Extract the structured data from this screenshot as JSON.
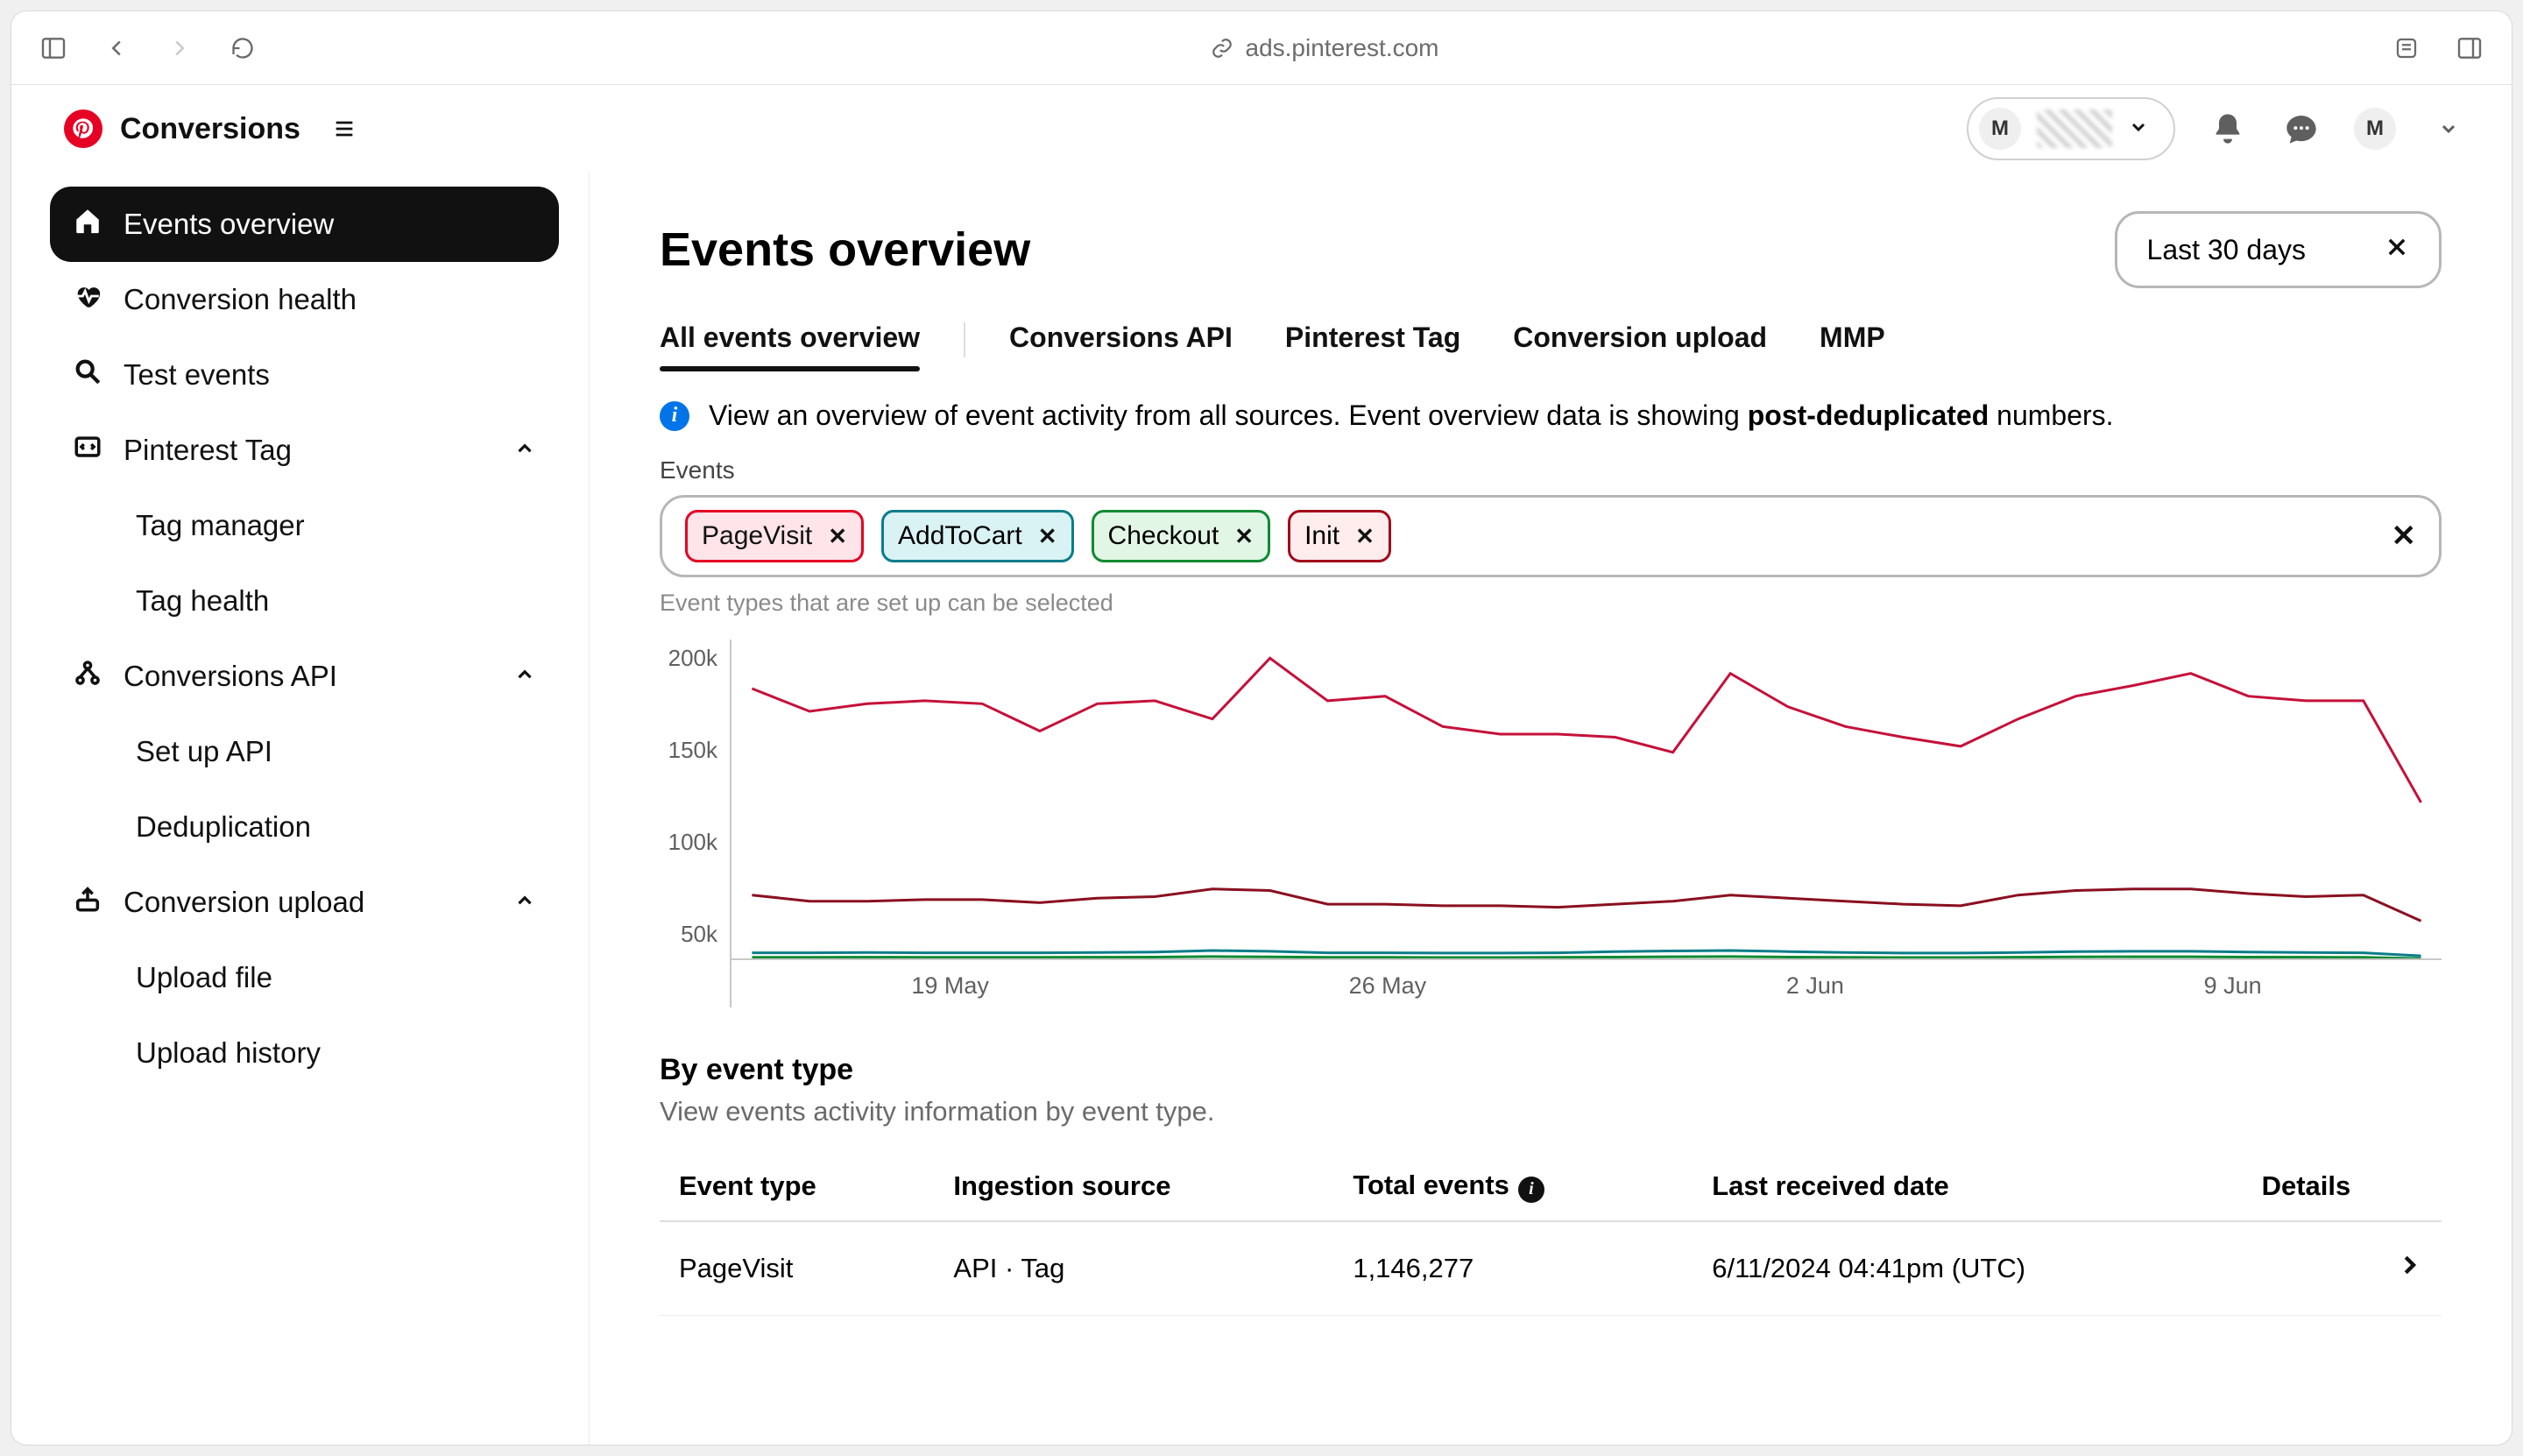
{
  "browser": {
    "url": "ads.pinterest.com"
  },
  "header": {
    "app_title": "Conversions",
    "account_initial": "M",
    "user_initial": "M"
  },
  "sidebar": {
    "items": [
      {
        "label": "Events overview"
      },
      {
        "label": "Conversion health"
      },
      {
        "label": "Test events"
      },
      {
        "label": "Pinterest Tag",
        "children": [
          {
            "label": "Tag manager"
          },
          {
            "label": "Tag health"
          }
        ]
      },
      {
        "label": "Conversions API",
        "children": [
          {
            "label": "Set up API"
          },
          {
            "label": "Deduplication"
          }
        ]
      },
      {
        "label": "Conversion upload",
        "children": [
          {
            "label": "Upload file"
          },
          {
            "label": "Upload history"
          }
        ]
      }
    ]
  },
  "main": {
    "title": "Events overview",
    "date_range": "Last 30 days",
    "tabs": [
      "All events overview",
      "Conversions API",
      "Pinterest Tag",
      "Conversion upload",
      "MMP"
    ],
    "info_prefix": "View an overview of event activity from all sources. Event overview data is showing ",
    "info_bold": "post-deduplicated",
    "info_suffix": " numbers.",
    "events_label": "Events",
    "chips": [
      {
        "label": "PageVisit",
        "color": "red"
      },
      {
        "label": "AddToCart",
        "color": "teal"
      },
      {
        "label": "Checkout",
        "color": "green"
      },
      {
        "label": "Init",
        "color": "darkred"
      }
    ],
    "chip_hint": "Event types that are set up can be selected",
    "section_title": "By event type",
    "section_sub": "View events activity information by event type.",
    "table": {
      "headers": [
        "Event type",
        "Ingestion source",
        "Total events",
        "Last received date",
        "Details"
      ],
      "rows": [
        {
          "type": "PageVisit",
          "source": "API · Tag",
          "total": "1,146,277",
          "last": "6/11/2024 04:41pm (UTC)"
        }
      ]
    }
  },
  "chart_data": {
    "type": "line",
    "ylabel": "",
    "xlabel": "",
    "ylim": [
      0,
      210000
    ],
    "y_ticks": [
      "200k",
      "150k",
      "100k",
      "50k"
    ],
    "x_ticks": [
      "19 May",
      "26 May",
      "2 Jun",
      "9 Jun"
    ],
    "x": [
      0,
      1,
      2,
      3,
      4,
      5,
      6,
      7,
      8,
      9,
      10,
      11,
      12,
      13,
      14,
      15,
      16,
      17,
      18,
      19,
      20,
      21,
      22,
      23,
      24,
      25,
      26,
      27,
      28,
      29
    ],
    "series": [
      {
        "name": "PageVisit",
        "color": "#c5113a",
        "values": [
          180000,
          165000,
          170000,
          172000,
          170000,
          152000,
          170000,
          172000,
          160000,
          200000,
          172000,
          175000,
          155000,
          150000,
          150000,
          148000,
          138000,
          190000,
          168000,
          155000,
          148000,
          142000,
          160000,
          175000,
          182000,
          190000,
          175000,
          172000,
          172000,
          105000
        ]
      },
      {
        "name": "Init",
        "color": "#8a1020",
        "values": [
          44000,
          40000,
          40000,
          41000,
          41000,
          39000,
          42000,
          43000,
          48000,
          47000,
          38000,
          38000,
          37000,
          37000,
          36000,
          38000,
          40000,
          44000,
          42000,
          40000,
          38000,
          37000,
          44000,
          47000,
          48000,
          48000,
          45000,
          43000,
          44000,
          27000
        ]
      },
      {
        "name": "AddToCart",
        "color": "#0a7d89",
        "values": [
          6000,
          6000,
          6200,
          6000,
          6000,
          6000,
          6200,
          6500,
          7500,
          7000,
          6000,
          6000,
          5800,
          5800,
          6000,
          6800,
          7200,
          7500,
          6800,
          6200,
          5800,
          5800,
          6200,
          6800,
          7000,
          7000,
          6500,
          6200,
          6000,
          4000
        ]
      },
      {
        "name": "Checkout",
        "color": "#0f8a32",
        "values": [
          3000,
          3000,
          3100,
          3000,
          3000,
          3000,
          3100,
          3200,
          3500,
          3300,
          3000,
          3000,
          2900,
          2900,
          3000,
          3200,
          3400,
          3500,
          3200,
          3000,
          2900,
          2900,
          3100,
          3300,
          3400,
          3400,
          3200,
          3100,
          3000,
          2200
        ]
      }
    ]
  }
}
